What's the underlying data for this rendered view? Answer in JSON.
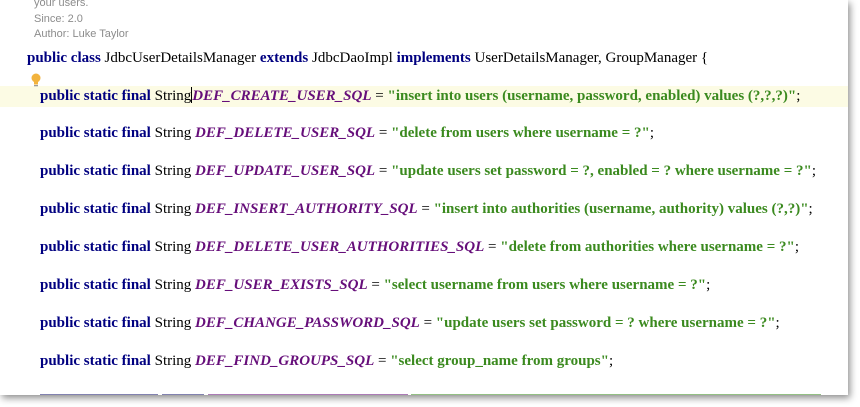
{
  "javadoc": {
    "line1": "your users.",
    "since": "Since:  2.0",
    "author": "Author: Luke Taylor"
  },
  "class_decl": {
    "kw_public": "public",
    "kw_class": "class",
    "name": "JdbcUserDetailsManager",
    "kw_extends": "extends",
    "superclass": "JdbcDaoImpl",
    "kw_implements": "implements",
    "interfaces": "UserDetailsManager, GroupManager {"
  },
  "decl_prefix": "public static final",
  "decl_type": "String",
  "fields": [
    {
      "name": "DEF_CREATE_USER_SQL",
      "value": "\"insert into users (username, password, enabled) values (?,?,?)\""
    },
    {
      "name": "DEF_DELETE_USER_SQL",
      "value": "\"delete from users where username = ?\""
    },
    {
      "name": "DEF_UPDATE_USER_SQL",
      "value": "\"update users set password = ?, enabled = ? where username = ?\""
    },
    {
      "name": "DEF_INSERT_AUTHORITY_SQL",
      "value": "\"insert into authorities (username, authority) values (?,?)\""
    },
    {
      "name": "DEF_DELETE_USER_AUTHORITIES_SQL",
      "value": "\"delete from authorities where username = ?\""
    },
    {
      "name": "DEF_USER_EXISTS_SQL",
      "value": "\"select username from users where username = ?\""
    },
    {
      "name": "DEF_CHANGE_PASSWORD_SQL",
      "value": "\"update users set password = ? where username = ?\""
    },
    {
      "name": "DEF_FIND_GROUPS_SQL",
      "value": "\"select group_name from groups\""
    }
  ],
  "colors": {
    "keyword": "#000080",
    "constant": "#660e7a",
    "string": "#3b8a1f",
    "javadoc": "#8c8c8c",
    "current_line": "#fcfbe4",
    "intention_bulb": "#f2b33d"
  },
  "icons": {
    "intention": "lightbulb-icon"
  }
}
